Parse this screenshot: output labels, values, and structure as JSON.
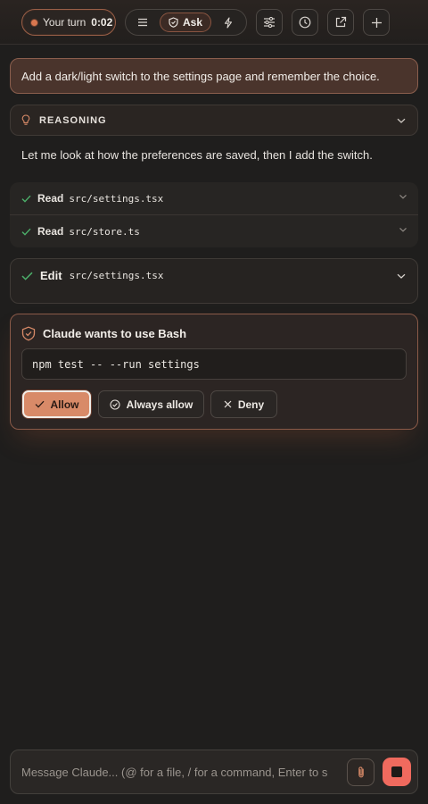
{
  "colors": {
    "background": "#1f1e1d",
    "accent": "#d88a68",
    "success": "#4caf6a",
    "stop": "#f06a5e"
  },
  "header": {
    "turn_label": "Your turn",
    "turn_timer": "0:02",
    "mode_active": "Ask",
    "icons": [
      "list-icon",
      "shield-icon",
      "bolt-icon",
      "sliders-icon",
      "history-icon",
      "external-link-icon",
      "plus-icon"
    ]
  },
  "conversation": {
    "user_message": "Add a dark/light switch to the settings page and remember the choice.",
    "reasoning_label": "REASONING",
    "assistant_text": "Let me look at how the preferences are saved, then I add the switch.",
    "reads": [
      {
        "verb": "Read",
        "path": "src/settings.tsx"
      },
      {
        "verb": "Read",
        "path": "src/store.ts"
      }
    ],
    "edit": {
      "verb": "Edit",
      "path": "src/settings.tsx"
    }
  },
  "permission": {
    "title": "Claude wants to use Bash",
    "command": "npm test -- --run settings",
    "allow_label": "Allow",
    "always_allow_label": "Always allow",
    "deny_label": "Deny"
  },
  "composer": {
    "placeholder": "Message Claude... (@ for a file, / for a command, Enter to send)"
  }
}
